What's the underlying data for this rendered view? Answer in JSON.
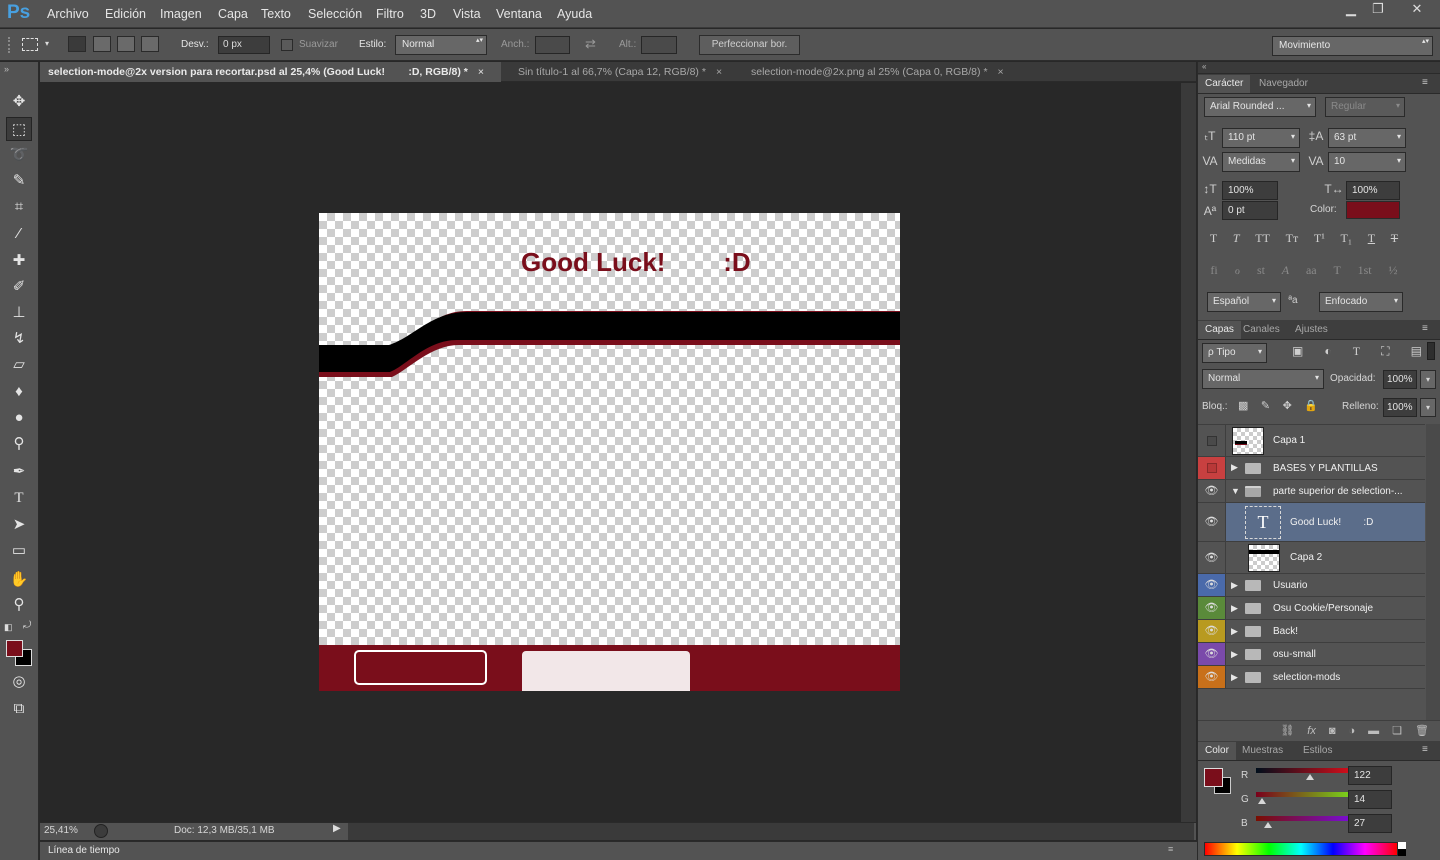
{
  "app": {
    "logo": "Ps"
  },
  "menu": [
    "Archivo",
    "Edición",
    "Imagen",
    "Capa",
    "Texto",
    "Selección",
    "Filtro",
    "3D",
    "Vista",
    "Ventana",
    "Ayuda"
  ],
  "window_controls": {
    "minimize": "▁",
    "restore": "❐",
    "close": "✕"
  },
  "options": {
    "feather_label": "Desv.:",
    "feather_value": "0 px",
    "antialias_label": "Suavizar",
    "style_label": "Estilo:",
    "style_value": "Normal",
    "width_label": "Anch.:",
    "height_label": "Alt.:",
    "refine_button": "Perfeccionar bor.",
    "workspace": "Movimiento"
  },
  "tabs": [
    {
      "title": "selection-mode@2x version para recortar.psd al 25,4% (Good Luck!        :D, RGB/8) *",
      "close": "×"
    },
    {
      "title": "Sin título-1 al 66,7% (Capa 12, RGB/8) *",
      "close": "×"
    },
    {
      "title": "selection-mode@2x.png al 25% (Capa 0, RGB/8) *",
      "close": "×"
    }
  ],
  "canvas": {
    "text": "Good Luck!        :D",
    "accent_color": "#7a0e1b"
  },
  "status": {
    "zoom": "25,41%",
    "doc": "Doc: 12,3 MB/35,1 MB"
  },
  "timeline": {
    "label": "Línea de tiempo"
  },
  "character_panel": {
    "tabs": [
      "Carácter",
      "Navegador"
    ],
    "font_family": "Arial Rounded ...",
    "font_style": "Regular",
    "size": "110 pt",
    "leading": "63 pt",
    "kerning": "Medidas",
    "tracking": "10",
    "vscale": "100%",
    "hscale": "100%",
    "baseline": "0 pt",
    "color_label": "Color:",
    "color": "#7a0e1b",
    "style_buttons": [
      "T",
      "T",
      "TT",
      "Tт",
      "T¹",
      "T₁",
      "T",
      "T"
    ],
    "opentype_buttons": [
      "fi",
      "ℴ",
      "st",
      "A",
      "aa",
      "T",
      "1st",
      "½"
    ],
    "language": "Español",
    "antialias": "Enfocado",
    "aa_icon": "ªa"
  },
  "layers_panel": {
    "tabs": [
      "Capas",
      "Canales",
      "Ajustes"
    ],
    "filter": "ρ Tipo",
    "blend_mode": "Normal",
    "opacity_label": "Opacidad:",
    "opacity": "100%",
    "lock_label": "Bloq.:",
    "fill_label": "Relleno:",
    "fill": "100%",
    "layers": [
      {
        "name": "Capa 1",
        "kind": "pixel",
        "color": "",
        "visible": false
      },
      {
        "name": "BASES Y PLANTILLAS",
        "kind": "group",
        "color": "#c84040",
        "visible": false
      },
      {
        "name": "parte superior de selection-...",
        "kind": "group-open",
        "color": "",
        "visible": true
      },
      {
        "name": "Good Luck!        :D",
        "kind": "text",
        "color": "",
        "visible": true,
        "selected": true
      },
      {
        "name": "Capa 2",
        "kind": "pixel",
        "color": "",
        "visible": true
      },
      {
        "name": "Usuario",
        "kind": "group",
        "color": "#4a6aaa",
        "visible": true
      },
      {
        "name": "Osu Cookie/Personaje",
        "kind": "group",
        "color": "#5a8a3a",
        "visible": true
      },
      {
        "name": "Back!",
        "kind": "group",
        "color": "#b89a20",
        "visible": true
      },
      {
        "name": "osu-small",
        "kind": "group",
        "color": "#7a4aaa",
        "visible": true
      },
      {
        "name": "selection-mods",
        "kind": "group",
        "color": "#c8701a",
        "visible": true
      }
    ],
    "text_layer_glyph": "T",
    "eye_glyph": "👁",
    "footer_icons": [
      "link-icon",
      "fx-icon",
      "mask-icon",
      "adjustment-icon",
      "folder-icon",
      "new-layer-icon",
      "trash-icon"
    ]
  },
  "color_panel": {
    "tabs": [
      "Color",
      "Muestras",
      "Estilos"
    ],
    "r_label": "R",
    "g_label": "G",
    "b_label": "B",
    "r": "122",
    "g": "14",
    "b": "27",
    "r_fraction": 0.478,
    "g_fraction": 0.055,
    "b_fraction": 0.106,
    "foreground": "#7a0e1b",
    "background": "#000000"
  }
}
